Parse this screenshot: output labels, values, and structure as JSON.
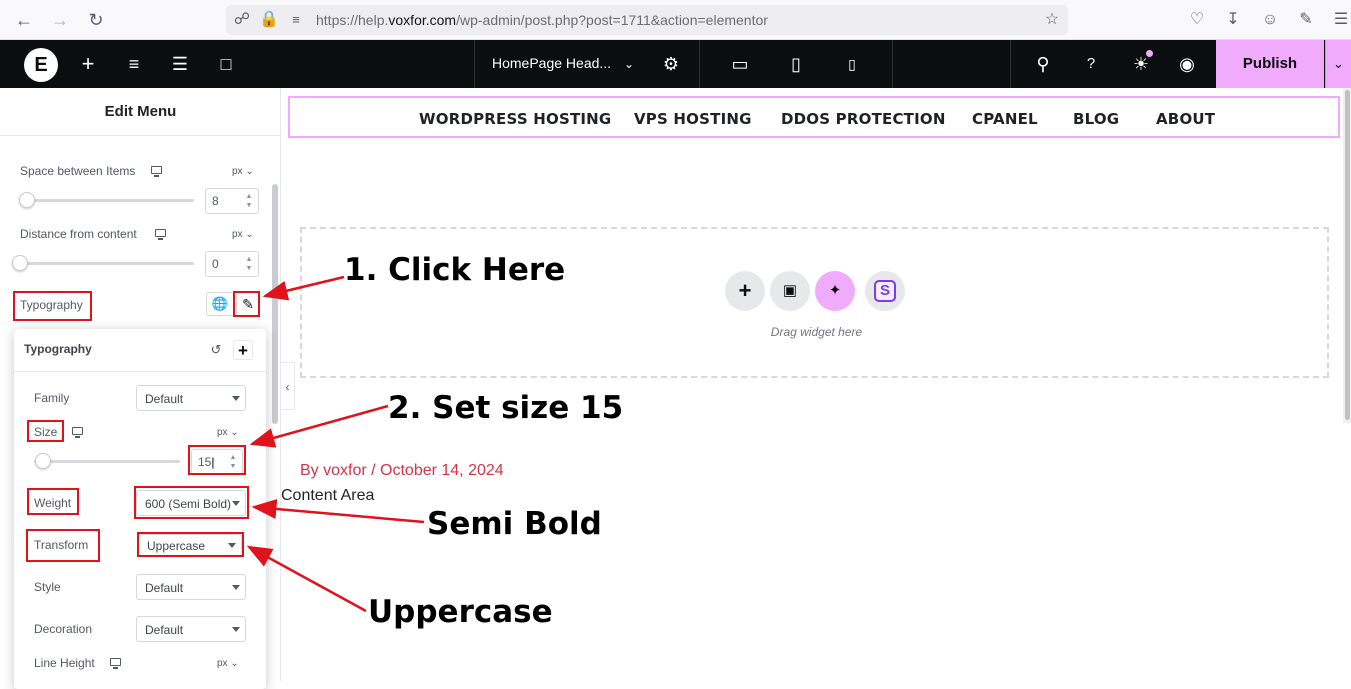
{
  "browser": {
    "url_prefix": "https://help.",
    "url_domain": "voxfor.com",
    "url_rest": "/wp-admin/post.php?post=1711&action=elementor"
  },
  "topbar": {
    "logo": "E",
    "document_title": "HomePage Head...",
    "publish_label": "Publish"
  },
  "panel": {
    "title": "Edit Menu",
    "space_between_items": {
      "label": "Space between Items",
      "unit": "px",
      "value": "8"
    },
    "distance_from_content": {
      "label": "Distance from content",
      "unit": "px",
      "value": "0"
    },
    "typography_label": "Typography"
  },
  "typography_popover": {
    "title": "Typography",
    "family": {
      "label": "Family",
      "value": "Default"
    },
    "size": {
      "label": "Size",
      "unit": "px",
      "value": "15"
    },
    "weight": {
      "label": "Weight",
      "value": "600 (Semi Bold)"
    },
    "transform": {
      "label": "Transform",
      "value": "Uppercase"
    },
    "style": {
      "label": "Style",
      "value": "Default"
    },
    "decoration": {
      "label": "Decoration",
      "value": "Default"
    },
    "line_height": {
      "label": "Line Height",
      "unit": "px"
    }
  },
  "canvas": {
    "nav_items": [
      "WORDPRESS HOSTING",
      "VPS HOSTING",
      "DDOS PROTECTION",
      "CPANEL",
      "BLOG",
      "ABOUT"
    ],
    "drag_text": "Drag widget here",
    "post_meta": "By voxfor / October 14, 2024",
    "content_area": "Content Area"
  },
  "annotations": {
    "step1": "1. Click Here",
    "step2": "2. Set size 15",
    "semi_bold": "Semi Bold",
    "uppercase": "Uppercase"
  },
  "colors": {
    "accent_pink": "#f0abfc",
    "annotation_red": "#e0121c",
    "meta_red": "#d5334b"
  }
}
